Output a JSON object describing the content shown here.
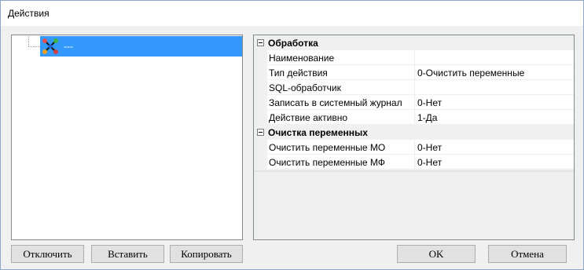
{
  "window": {
    "title": "Действия"
  },
  "tree": {
    "items": [
      {
        "label": "---",
        "icon": "action-node-icon"
      }
    ]
  },
  "grid": {
    "categories": [
      {
        "label": "Обработка",
        "props": [
          {
            "name": "Наименование",
            "value": ""
          },
          {
            "name": "Тип действия",
            "value": "0-Очистить переменные"
          },
          {
            "name": "SQL-обработчик",
            "value": ""
          },
          {
            "name": "Записать в системный журнал",
            "value": "0-Нет"
          },
          {
            "name": "Действие активно",
            "value": "1-Да"
          }
        ]
      },
      {
        "label": "Очистка переменных",
        "props": [
          {
            "name": "Очистить переменные МО",
            "value": "0-Нет"
          },
          {
            "name": "Очистить переменные МФ",
            "value": "0-Нет"
          }
        ]
      }
    ]
  },
  "buttons": {
    "disable": "Отключить",
    "paste": "Вставить",
    "copy": "Копировать",
    "ok": "OK",
    "cancel": "Отмена"
  }
}
